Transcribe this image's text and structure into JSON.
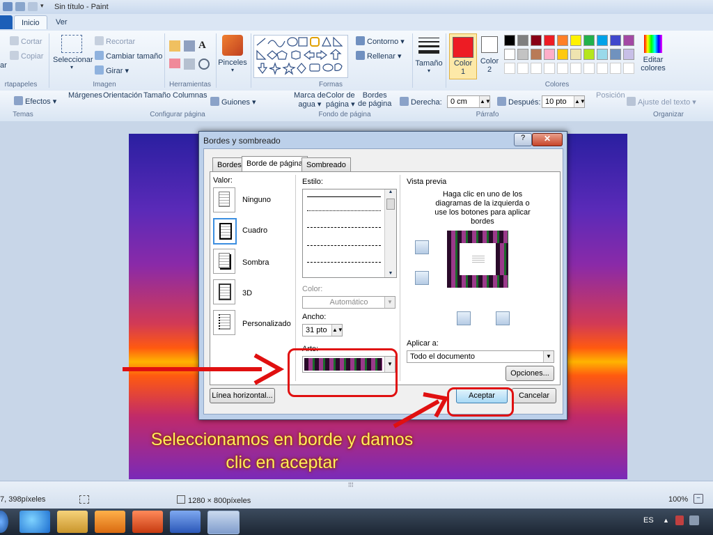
{
  "window": {
    "title": "Sin título - Paint"
  },
  "tabs": [
    {
      "label": "Inicio",
      "active": true
    },
    {
      "label": "Ver",
      "active": false
    }
  ],
  "ribbon": {
    "portapapeles": {
      "group_label": "rtapapeles",
      "cut": "Cortar",
      "copy": "Copiar"
    },
    "imagen": {
      "group_label": "Imagen",
      "select": "Seleccionar",
      "crop": "Recortar",
      "resize": "Cambiar tamaño",
      "rotate": "Girar ▾"
    },
    "herramientas": {
      "group_label": "Herramientas"
    },
    "pinceles": {
      "label": "Pinceles"
    },
    "formas": {
      "group_label": "Formas",
      "outline": "Contorno ▾",
      "fill": "Rellenar ▾"
    },
    "tamano": {
      "label": "Tamaño"
    },
    "colores": {
      "group_label": "Colores",
      "color1": "Color",
      "color1_n": "1",
      "color2": "Color",
      "color2_n": "2",
      "edit": "Editar",
      "edit2": "colores"
    },
    "swatches_row1": [
      "#000000",
      "#7f7f7f",
      "#880015",
      "#ed1c24",
      "#ff7f27",
      "#fff200",
      "#22b14c",
      "#00a2e8",
      "#3f48cc",
      "#a349a4"
    ],
    "swatches_row2": [
      "#ffffff",
      "#c3c3c3",
      "#b97a57",
      "#ffaec9",
      "#ffc90e",
      "#efe4b0",
      "#b5e61d",
      "#99d9ea",
      "#7092be",
      "#c8bfe7"
    ],
    "color1_value": "#ed1c24"
  },
  "word_ribbon": {
    "effects": "Efectos ▾",
    "temas": "Temas",
    "margins": "Márgenes",
    "orientation": "Orientación",
    "size": "Tamaño",
    "columns": "Columnas",
    "hyphens": "Guiones ▾",
    "page_setup": "Configurar página",
    "watermark1": "Marca de",
    "watermark2": "agua ▾",
    "pagecolor1": "Color de",
    "pagecolor2": "página ▾",
    "borders1": "Bordes",
    "borders2": "de página",
    "page_bg": "Fondo de página",
    "right_label": "Derecha:",
    "right_value": "0 cm",
    "after_label": "Después:",
    "after_value": "10 pto",
    "paragraph": "Párrafo",
    "position": "Posición",
    "wrap": "Ajuste del texto ▾",
    "organize": "Organizar"
  },
  "dialog": {
    "title": "Bordes y sombreado",
    "help": "?",
    "close": "✕",
    "tabs": [
      "Bordes",
      "Borde de página",
      "Sombreado"
    ],
    "value_label": "Valor:",
    "settings": [
      "Ninguno",
      "Cuadro",
      "Sombra",
      "3D",
      "Personalizado"
    ],
    "style_label": "Estilo:",
    "color_label": "Color:",
    "color_value": "Automático",
    "width_label": "Ancho:",
    "width_value": "31 pto",
    "art_label": "Arte:",
    "preview_label": "Vista previa",
    "preview_hint": "Haga clic en uno de los diagramas de la izquierda o use los botones para aplicar bordes",
    "apply_label": "Aplicar a:",
    "apply_value": "Todo el documento",
    "options_button": "Opciones...",
    "hline_button": "Línea horizontal...",
    "ok_button": "Aceptar",
    "cancel_button": "Cancelar"
  },
  "caption": {
    "line1": "Seleccionamos en borde y damos",
    "line2": "clic en aceptar"
  },
  "status": {
    "position": "7, 398píxeles",
    "size": "1280 × 800píxeles",
    "zoom": "100%"
  },
  "taskbar": {
    "lang": "ES"
  }
}
